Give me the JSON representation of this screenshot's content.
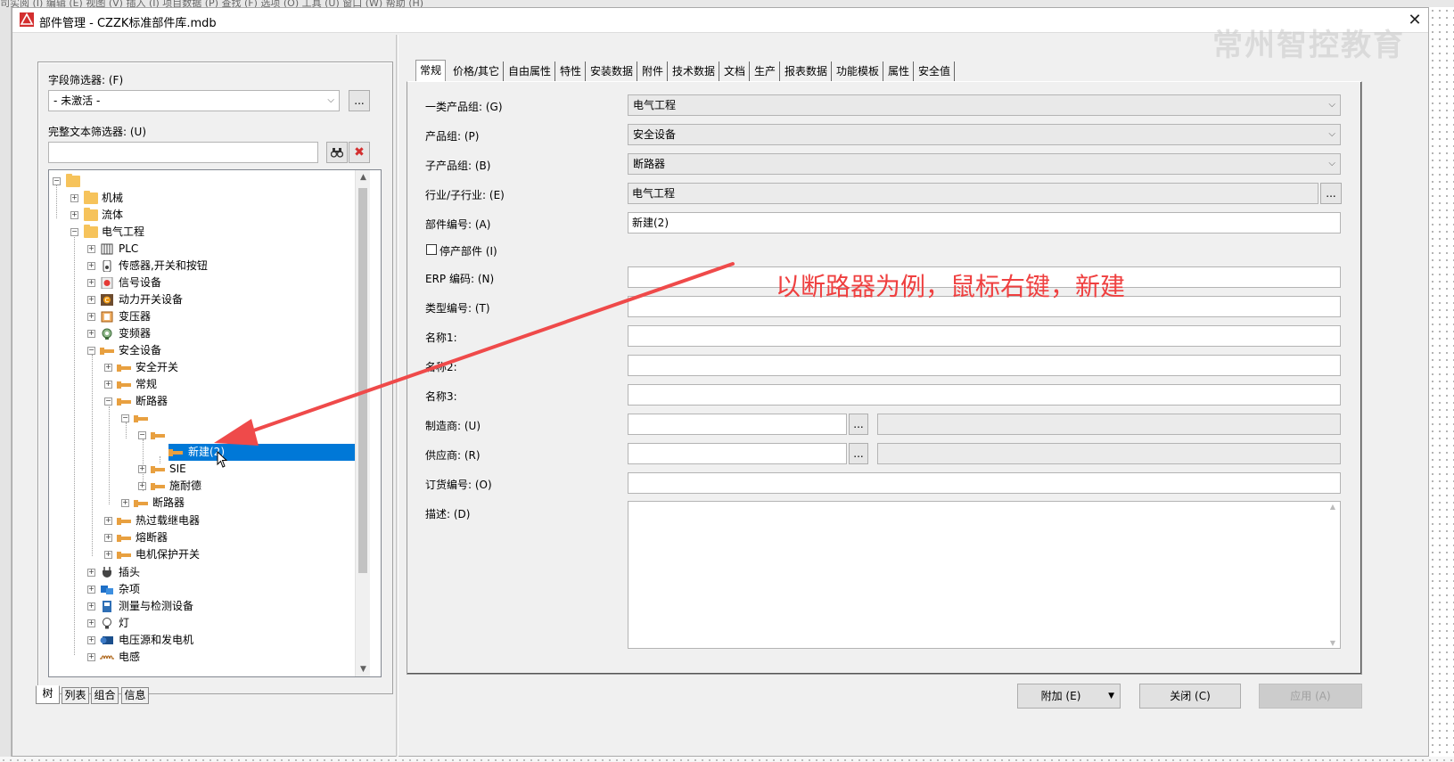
{
  "background_app": {
    "menubar_fragment": "司实阅 (I)   编辑 (E)   视图 (V)   插入 (I)   项目数据 (P)   查找 (F)   选项 (O)   工具 (U)   窗口 (W)   帮助 (H)"
  },
  "dialog": {
    "title": "部件管理 - CZZK标准部件库.mdb",
    "watermark": "常州智控教育",
    "close_glyph": "✕"
  },
  "left_panel": {
    "field_filter_label": "字段筛选器: (F)",
    "field_filter_value": "- 未激活 -",
    "browse_label": "...",
    "full_text_filter_label": "完整文本筛选器: (U)",
    "full_text_filter_value": "",
    "tree": {
      "nodes": [
        {
          "label": "机械"
        },
        {
          "label": "流体"
        },
        {
          "label": "电气工程"
        },
        {
          "label": "PLC"
        },
        {
          "label": "传感器,开关和按钮"
        },
        {
          "label": "信号设备"
        },
        {
          "label": "动力开关设备"
        },
        {
          "label": "变压器"
        },
        {
          "label": "变频器"
        },
        {
          "label": "安全设备"
        },
        {
          "label": "安全开关"
        },
        {
          "label": "常规"
        },
        {
          "label": "断路器"
        },
        {
          "label": ""
        },
        {
          "label": ""
        },
        {
          "label": "新建(2)"
        },
        {
          "label": "SIE"
        },
        {
          "label": "施耐德"
        },
        {
          "label": "断路器"
        },
        {
          "label": "热过载继电器"
        },
        {
          "label": "熔断器"
        },
        {
          "label": "电机保护开关"
        },
        {
          "label": "插头"
        },
        {
          "label": "杂项"
        },
        {
          "label": "测量与检测设备"
        },
        {
          "label": "灯"
        },
        {
          "label": "电压源和发电机"
        },
        {
          "label": "电感"
        }
      ]
    },
    "bottom_tabs": [
      "树",
      "列表",
      "组合",
      "信息"
    ]
  },
  "right_panel": {
    "tabs": [
      "常规",
      "价格/其它",
      "自由属性",
      "特性",
      "安装数据",
      "附件",
      "技术数据",
      "文档",
      "生产",
      "报表数据",
      "功能模板",
      "属性",
      "安全值"
    ],
    "fields": {
      "product_group_1_label": "一类产品组: (G)",
      "product_group_1_value": "电气工程",
      "product_group_label": "产品组: (P)",
      "product_group_value": "安全设备",
      "sub_product_group_label": "子产品组: (B)",
      "sub_product_group_value": "断路器",
      "industry_label": "行业/子行业: (E)",
      "industry_value": "电气工程",
      "part_number_label": "部件编号: (A)",
      "part_number_value": "新建(2)",
      "discontinued_label": "停产部件 (I)",
      "erp_label": "ERP 编码: (N)",
      "type_number_label": "类型编号: (T)",
      "name1_label": "名称1:",
      "name2_label": "名称2:",
      "name3_label": "名称3:",
      "manufacturer_label": "制造商: (U)",
      "supplier_label": "供应商: (R)",
      "order_number_label": "订货编号: (O)",
      "description_label": "描述: (D)",
      "browse_label": "..."
    }
  },
  "buttons": {
    "extra_label": "附加 (E)",
    "close_label": "关闭 (C)",
    "apply_label": "应用 (A)"
  },
  "annotation": {
    "text": "以断路器为例，鼠标右键，新建",
    "color": "#ef4040"
  },
  "colors": {
    "selection": "#0078d7",
    "folder": "#f6c35b"
  }
}
